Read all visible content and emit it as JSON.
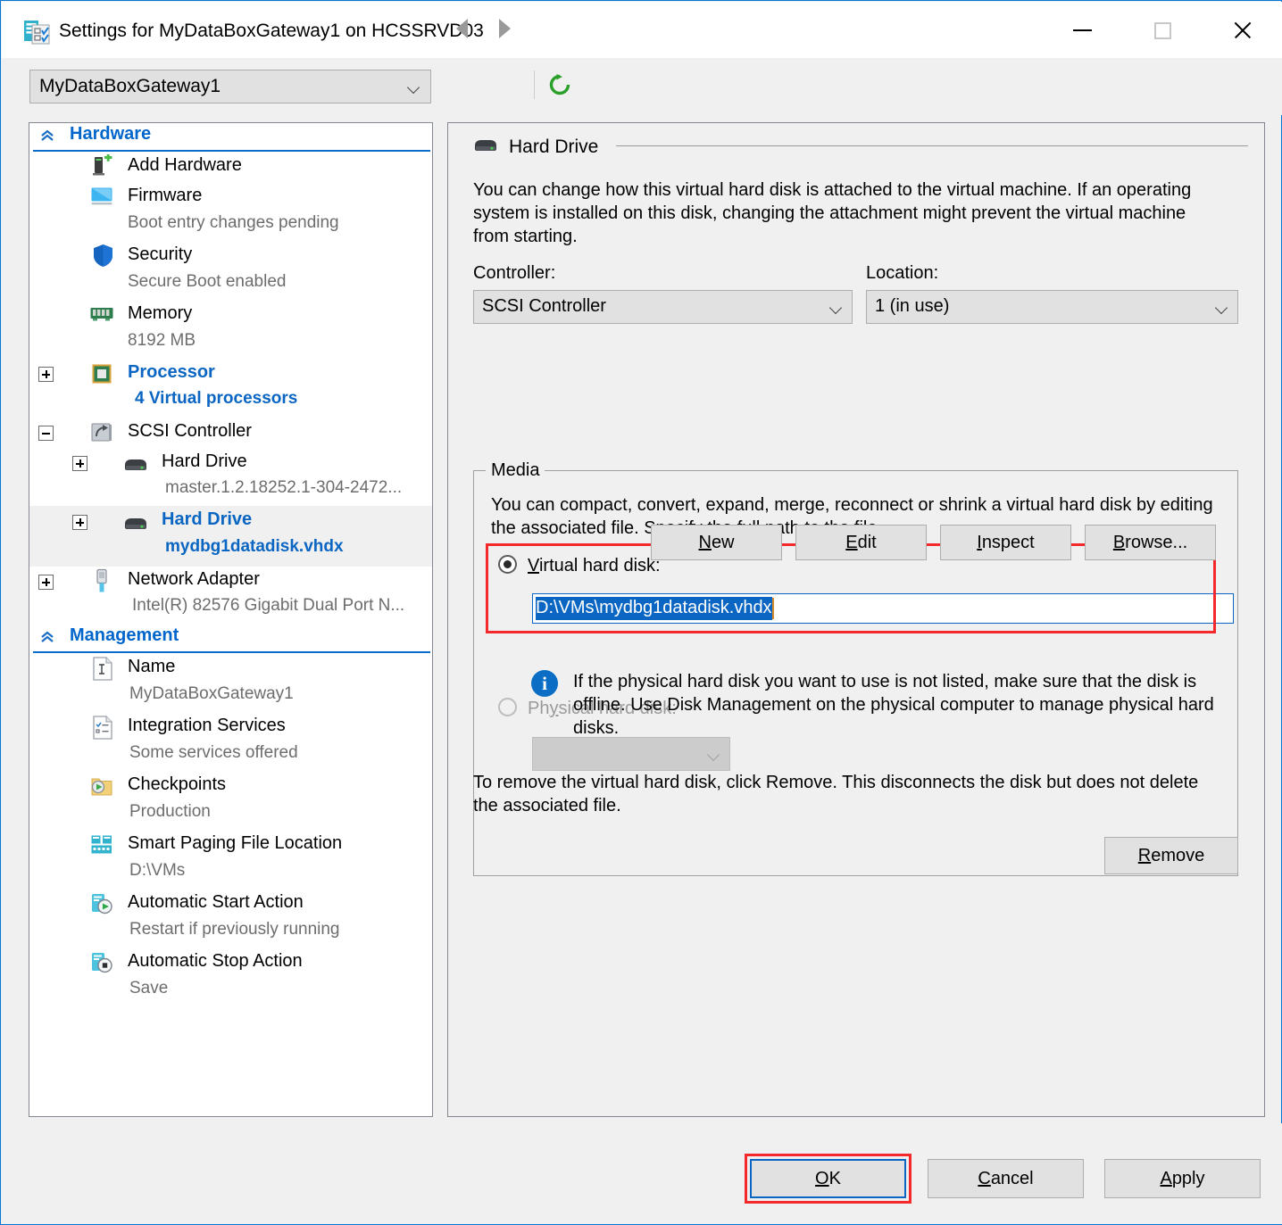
{
  "window": {
    "title": "Settings for MyDataBoxGateway1 on HCSSRVD03",
    "icon": "settings-vm-icon",
    "minimize_label": "Minimize",
    "maximize_label": "Maximize",
    "close_label": "Close"
  },
  "toolbar": {
    "vm_selector_value": "MyDataBoxGateway1",
    "back_label": "Back",
    "forward_label": "Forward",
    "refresh_label": "Refresh"
  },
  "sidebar": {
    "sections": [
      {
        "label": "Hardware",
        "items": [
          {
            "label": "Add Hardware",
            "sub": "",
            "icon": "add-hardware-icon",
            "expander": "",
            "selected": false
          },
          {
            "label": "Firmware",
            "sub": "Boot entry changes pending",
            "icon": "firmware-icon",
            "expander": "",
            "selected": false
          },
          {
            "label": "Security",
            "sub": "Secure Boot enabled",
            "icon": "security-shield-icon",
            "expander": "",
            "selected": false
          },
          {
            "label": "Memory",
            "sub": "8192 MB",
            "icon": "memory-icon",
            "expander": "",
            "selected": false
          },
          {
            "label": "Processor",
            "sub": "4 Virtual processors",
            "icon": "processor-icon",
            "expander": "plus",
            "selected": true
          },
          {
            "label": "SCSI Controller",
            "sub": "",
            "icon": "scsi-controller-icon",
            "expander": "minus",
            "selected": false
          },
          {
            "label": "Hard Drive",
            "sub": "master.1.2.18252.1-304-2472...",
            "icon": "hard-drive-icon",
            "expander": "plus",
            "selected": false
          },
          {
            "label": "Hard Drive",
            "sub": "mydbg1datadisk.vhdx",
            "icon": "hard-drive-icon",
            "expander": "plus",
            "selected": true
          },
          {
            "label": "Network Adapter",
            "sub": "Intel(R) 82576 Gigabit Dual Port N...",
            "icon": "network-adapter-icon",
            "expander": "plus",
            "selected": false
          }
        ]
      },
      {
        "label": "Management",
        "items": [
          {
            "label": "Name",
            "sub": "MyDataBoxGateway1",
            "icon": "name-icon",
            "expander": "",
            "selected": false
          },
          {
            "label": "Integration Services",
            "sub": "Some services offered",
            "icon": "integration-services-icon",
            "expander": "",
            "selected": false
          },
          {
            "label": "Checkpoints",
            "sub": "Production",
            "icon": "checkpoints-icon",
            "expander": "",
            "selected": false
          },
          {
            "label": "Smart Paging File Location",
            "sub": "D:\\VMs",
            "icon": "smart-paging-icon",
            "expander": "",
            "selected": false
          },
          {
            "label": "Automatic Start Action",
            "sub": "Restart if previously running",
            "icon": "auto-start-icon",
            "expander": "",
            "selected": false
          },
          {
            "label": "Automatic Stop Action",
            "sub": "Save",
            "icon": "auto-stop-icon",
            "expander": "",
            "selected": false
          }
        ]
      }
    ]
  },
  "details": {
    "header": "Hard Drive",
    "header_icon": "hard-drive-icon",
    "description": "You can change how this virtual hard disk is attached to the virtual machine. If an operating system is installed on this disk, changing the attachment might prevent the virtual machine from starting.",
    "controller_label": "Controller:",
    "controller_value": "SCSI Controller",
    "location_label": "Location:",
    "location_value": "1 (in use)",
    "media": {
      "group_label": "Media",
      "description": "You can compact, convert, expand, merge, reconnect or shrink a virtual hard disk by editing the associated file. Specify the full path to the file.",
      "virtual_radio_label": "Virtual hard disk:",
      "virtual_radio_selected": true,
      "virtual_path_value": "D:\\VMs\\mydbg1datadisk.vhdx",
      "buttons": [
        "New",
        "Edit",
        "Inspect",
        "Browse..."
      ],
      "physical_radio_label": "Physical hard disk:",
      "physical_radio_selected": false,
      "physical_value": "",
      "info_icon": "info-icon",
      "info_text": "If the physical hard disk you want to use is not listed, make sure that the disk is offline. Use Disk Management on the physical computer to manage physical hard disks."
    },
    "remove_description": "To remove the virtual hard disk, click Remove. This disconnects the disk but does not delete the associated file.",
    "remove_label": "Remove"
  },
  "footer": {
    "ok_label": "OK",
    "cancel_label": "Cancel",
    "apply_label": "Apply"
  },
  "colors": {
    "accent": "#0a66c2",
    "highlight_box": "#f3292b",
    "section_header": "#0066cc",
    "dialog_bg": "#f0f0f0"
  }
}
